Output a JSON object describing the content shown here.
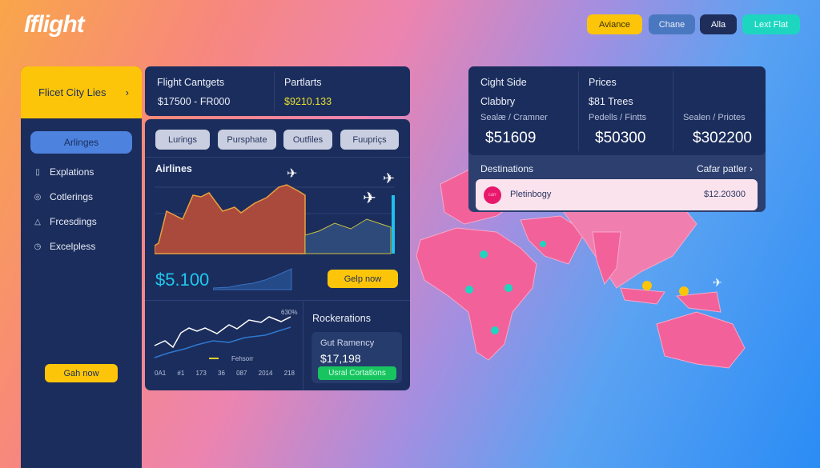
{
  "logo": "ſflight",
  "top_buttons": [
    {
      "label": "Aviance",
      "color": "#fdc50a"
    },
    {
      "label": "Chane",
      "color": "#4a78c0"
    },
    {
      "label": "Alla",
      "color": "#1e2d5a"
    },
    {
      "label": "Lext Flat",
      "color": "#1ed6c0"
    }
  ],
  "sidebar": {
    "header": "Flicet City Lies",
    "active": "Arlinges",
    "items": [
      {
        "label": "Explations",
        "icon": "clipboard-icon"
      },
      {
        "label": "Cotlerings",
        "icon": "search-icon"
      },
      {
        "label": "Frcesdings",
        "icon": "bell-icon"
      },
      {
        "label": "Excelpless",
        "icon": "clock-icon"
      }
    ],
    "cta": "Gah now"
  },
  "summary": {
    "left_title": "Flight Cantgets",
    "left_value": "$17500 - FR000",
    "right_title": "Partlarts",
    "right_value": "$9210.133"
  },
  "filters": [
    "Lurings",
    "Pursphate",
    "Outfiles",
    "Fuupriçs"
  ],
  "airlines": {
    "title": "Airlines",
    "price": "$5.100",
    "cta": "Gelp now"
  },
  "trend": {
    "tag": "630%",
    "legend": "Fehsorr",
    "ticks": [
      "0A1",
      "#1",
      "173",
      "36",
      "087",
      "2014",
      "218"
    ]
  },
  "recommendations": {
    "title": "Rockerations",
    "card_title": "Gut Ramency",
    "card_value": "$17,198",
    "button": "Usral Cortatlons"
  },
  "stats": {
    "cols": [
      {
        "title": "Cight Side",
        "line": "Clabbry",
        "sub": "Sealæ / Cramner",
        "value": "$51609"
      },
      {
        "title": "Prices",
        "line": "$81 Trees",
        "sub": "Pedells / Fintts",
        "value": "$50300"
      },
      {
        "title": "",
        "line": "",
        "sub": "Sealen / Priotes",
        "value": "$302200"
      }
    ]
  },
  "destinations": {
    "title": "Destinations",
    "link": "Cafar patler",
    "row": {
      "badge": "carr",
      "name": "Pletinbogy",
      "price": "$12.20300"
    }
  },
  "colors": {
    "navy": "#1b2d5c",
    "yellow": "#fdc50a",
    "map": "#f2619a",
    "teal": "#1ed6c0"
  }
}
